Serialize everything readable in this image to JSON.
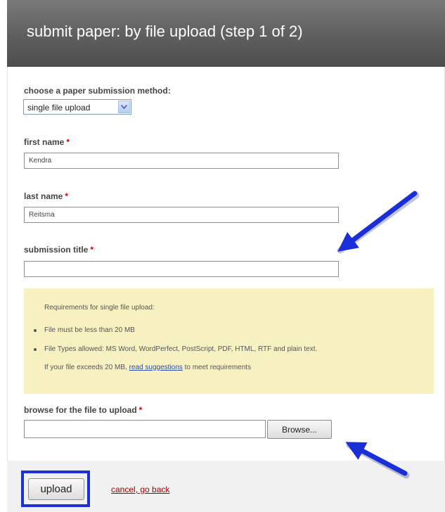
{
  "header": {
    "title": "submit paper: by file upload (step 1 of 2)"
  },
  "form": {
    "method": {
      "label": "choose a paper submission method:",
      "selected": "single file upload"
    },
    "first_name": {
      "label": "first name",
      "value": "Kendra"
    },
    "last_name": {
      "label": "last name",
      "value": "Reitsma"
    },
    "title": {
      "label": "submission title",
      "value": ""
    },
    "required_marker": "*"
  },
  "requirements": {
    "heading": "Requirements for single file upload:",
    "items": [
      "File must be less than 20 MB",
      "File Types allowed: MS Word, WordPerfect, PostScript, PDF, HTML, RTF and plain text."
    ],
    "note_prefix": "If your file exceeds 20 MB, ",
    "note_link": "read suggestions",
    "note_suffix": " to meet requirements"
  },
  "upload": {
    "label": "browse for the file to upload",
    "browse_label": "Browse...",
    "submit_label": "upload",
    "cancel_label": "cancel, go back"
  },
  "colors": {
    "annotation_arrow": "#1b2fd8",
    "required_marker": "#cc0000",
    "requirements_bg": "#f7f1c2",
    "cancel_link": "#990000"
  },
  "icons": {
    "select_arrow": "chevron-down-icon",
    "annotation": "arrow-icon"
  }
}
